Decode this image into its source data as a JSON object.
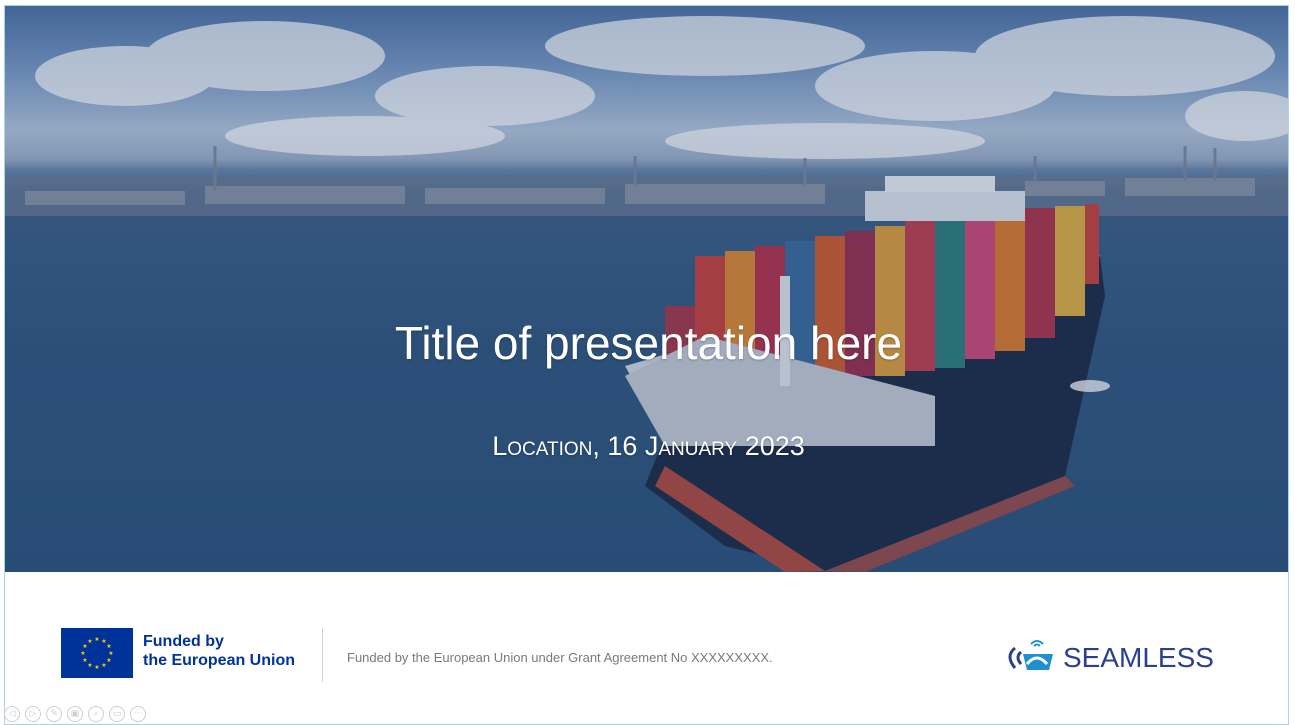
{
  "slide": {
    "title": "Title of presentation here",
    "subtitle": "Location, 16 January 2023"
  },
  "footer": {
    "eu_line1": "Funded by",
    "eu_line2": "the European Union",
    "grant_text": "Funded by the European Union under Grant Agreement No XXXXXXXXX.",
    "logo_text": "SEAMLESS"
  },
  "controls": [
    {
      "icon": "previous-icon",
      "glyph": "◁"
    },
    {
      "icon": "next-icon",
      "glyph": "▷"
    },
    {
      "icon": "pen-icon",
      "glyph": "✎"
    },
    {
      "icon": "slides-icon",
      "glyph": "▣"
    },
    {
      "icon": "zoom-icon",
      "glyph": "⌕"
    },
    {
      "icon": "subtitles-icon",
      "glyph": "▭"
    },
    {
      "icon": "more-icon",
      "glyph": "⋯"
    }
  ],
  "colors": {
    "eu_blue": "#003399",
    "logo_blue": "#2a3f8f",
    "grant_gray": "#7a7a7a"
  }
}
